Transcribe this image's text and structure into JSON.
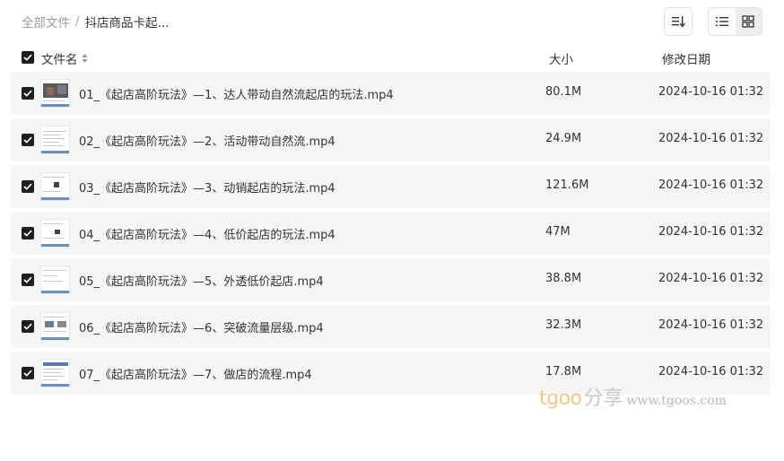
{
  "breadcrumb": {
    "root": "全部文件",
    "separator": "/",
    "current": "抖店商品卡起..."
  },
  "toolbar": {
    "sort_icon": "sort-icon",
    "list_view_icon": "list-view-icon",
    "grid_view_icon": "grid-view-icon",
    "active_view": "list"
  },
  "table": {
    "headers": {
      "name": "文件名",
      "size": "大小",
      "date": "修改日期"
    },
    "rows": [
      {
        "name": "01_《起店高阶玩法》—1、达人带动自然流起店的玩法.mp4",
        "size": "80.1M",
        "date": "2024-10-16 01:32",
        "checked": true
      },
      {
        "name": "02_《起店高阶玩法》—2、活动带动自然流.mp4",
        "size": "24.9M",
        "date": "2024-10-16 01:32",
        "checked": true
      },
      {
        "name": "03_《起店高阶玩法》—3、动销起店的玩法.mp4",
        "size": "121.6M",
        "date": "2024-10-16 01:32",
        "checked": true
      },
      {
        "name": "04_《起店高阶玩法》—4、低价起店的玩法.mp4",
        "size": "47M",
        "date": "2024-10-16 01:32",
        "checked": true
      },
      {
        "name": "05_《起店高阶玩法》—5、外透低价起店.mp4",
        "size": "38.8M",
        "date": "2024-10-16 01:32",
        "checked": true
      },
      {
        "name": "06_《起店高阶玩法》—6、突破流量层级.mp4",
        "size": "32.3M",
        "date": "2024-10-16 01:32",
        "checked": true
      },
      {
        "name": "07_《起店高阶玩法》—7、做店的流程.mp4",
        "size": "17.8M",
        "date": "2024-10-16 01:32",
        "checked": true
      }
    ]
  },
  "watermark": {
    "brand": "tgoo",
    "share": "分享",
    "url": "www.tgoos.com"
  },
  "colors": {
    "row_bg": "#f5f5f6",
    "checkbox": "#1f1f1f",
    "watermark_brand": "#f1c98a"
  }
}
